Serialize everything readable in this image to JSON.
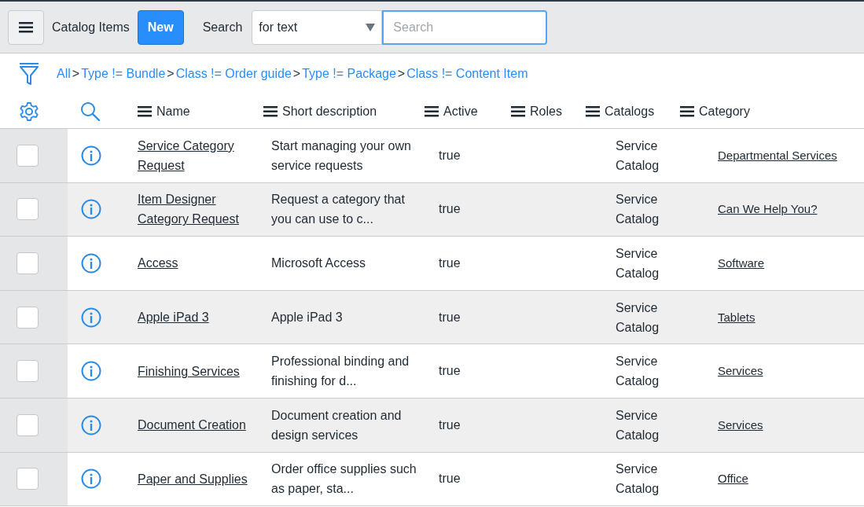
{
  "header": {
    "title": "Catalog Items",
    "new_button": "New",
    "search_label": "Search",
    "search_scope": "for text",
    "search_placeholder": "Search"
  },
  "breadcrumbs": [
    "All",
    "Type != Bundle",
    "Class != Order guide",
    "Type != Package",
    "Class != Content Item"
  ],
  "breadcrumb_separator": ">",
  "columns": [
    "Name",
    "Short description",
    "Active",
    "Roles",
    "Catalogs",
    "Category"
  ],
  "rows": [
    {
      "checked": false,
      "name": "Service Category Request",
      "description": "Start managing your own service requests",
      "active": "true",
      "roles": "",
      "catalogs": "Service Catalog",
      "category": "Departmental Services"
    },
    {
      "checked": false,
      "name": "Item Designer Category Request",
      "description": "Request a category that you can use to c...",
      "active": "true",
      "roles": "",
      "catalogs": "Service Catalog",
      "category": "Can We Help You?"
    },
    {
      "checked": false,
      "name": "Access",
      "description": "Microsoft Access",
      "active": "true",
      "roles": "",
      "catalogs": "Service Catalog",
      "category": "Software"
    },
    {
      "checked": false,
      "name": "Apple iPad 3",
      "description": "Apple iPad 3",
      "active": "true",
      "roles": "",
      "catalogs": "Service Catalog",
      "category": "Tablets"
    },
    {
      "checked": false,
      "name": "Finishing Services",
      "description": "Professional binding and finishing for d...",
      "active": "true",
      "roles": "",
      "catalogs": "Service Catalog",
      "category": "Services"
    },
    {
      "checked": false,
      "name": "Document Creation",
      "description": "Document creation and design services",
      "active": "true",
      "roles": "",
      "catalogs": "Service Catalog",
      "category": "Services"
    },
    {
      "checked": false,
      "name": "Paper and Supplies",
      "description": "Order office supplies such as paper, sta...",
      "active": "true",
      "roles": "",
      "catalogs": "Service Catalog",
      "category": "Office"
    }
  ]
}
